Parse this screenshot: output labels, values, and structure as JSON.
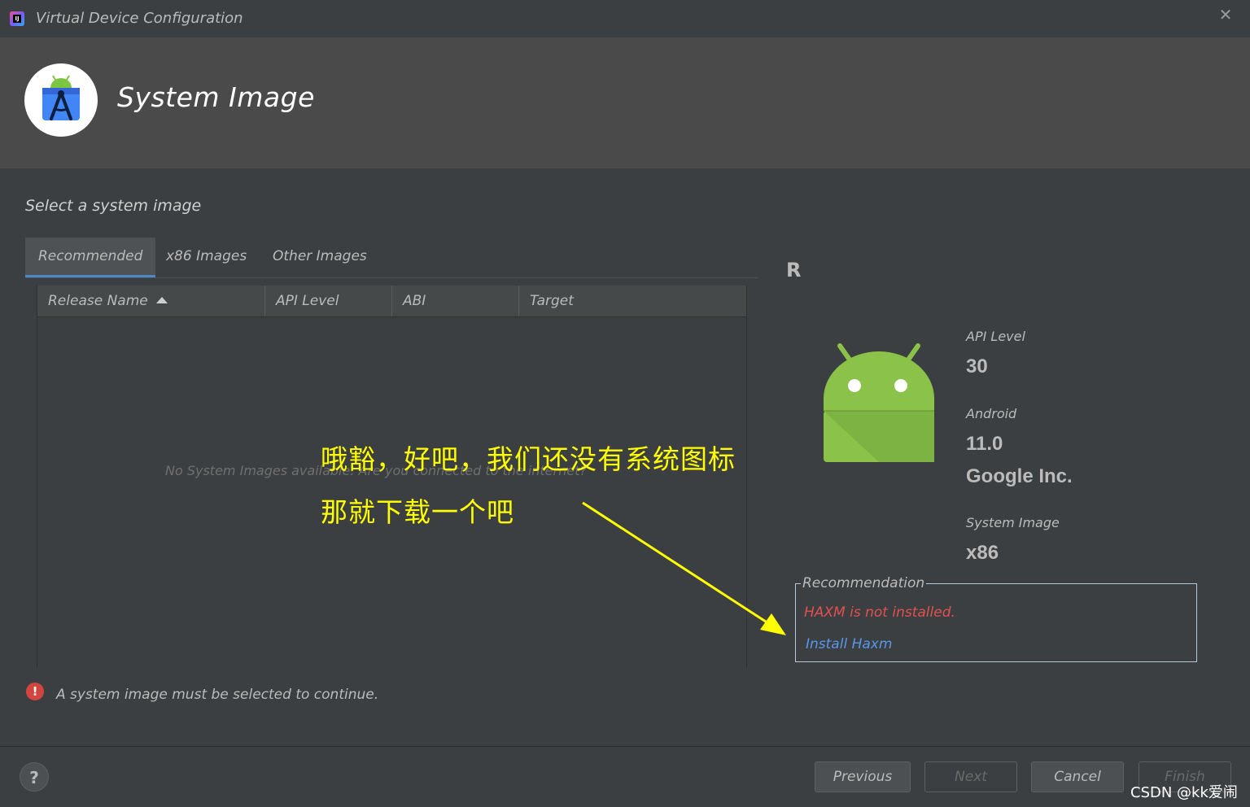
{
  "window": {
    "title": "Virtual Device Configuration",
    "app_icon_text": "IJ",
    "close_symbol": "✕"
  },
  "header": {
    "title": "System Image"
  },
  "page": {
    "subtitle": "Select a system image"
  },
  "tabs": [
    {
      "label": "Recommended",
      "active": true
    },
    {
      "label": "x86 Images",
      "active": false
    },
    {
      "label": "Other Images",
      "active": false
    }
  ],
  "table": {
    "columns": [
      "Release Name",
      "API Level",
      "ABI",
      "Target"
    ],
    "sorted_column": "Release Name",
    "sort_direction": "ascending",
    "empty_message": "No System Images available. Are you connected to the internet?"
  },
  "annotation": {
    "line1": "哦豁，好吧，我们还没有系统图标",
    "line2": "那就下载一个吧",
    "color": "#ffff00"
  },
  "details": {
    "release": "R",
    "api_level_label": "API Level",
    "api_level": "30",
    "android_label": "Android",
    "android_version": "11.0",
    "vendor": "Google Inc.",
    "system_image_label": "System Image",
    "system_image": "x86"
  },
  "recommendation": {
    "legend": "Recommendation",
    "warning": "HAXM is not installed.",
    "link": "Install Haxm"
  },
  "validation": {
    "message": "A system image must be selected to continue.",
    "icon": "!"
  },
  "footer": {
    "help": "?",
    "previous": "Previous",
    "next": "Next",
    "cancel": "Cancel",
    "finish": "Finish"
  },
  "watermark": "CSDN @kk爱闹",
  "colors": {
    "background": "#3c3f41",
    "header": "#4a4a4a",
    "accent": "#4a88c7",
    "error": "#e2504f",
    "link": "#5897e8",
    "android_green": "#8bc34a"
  }
}
